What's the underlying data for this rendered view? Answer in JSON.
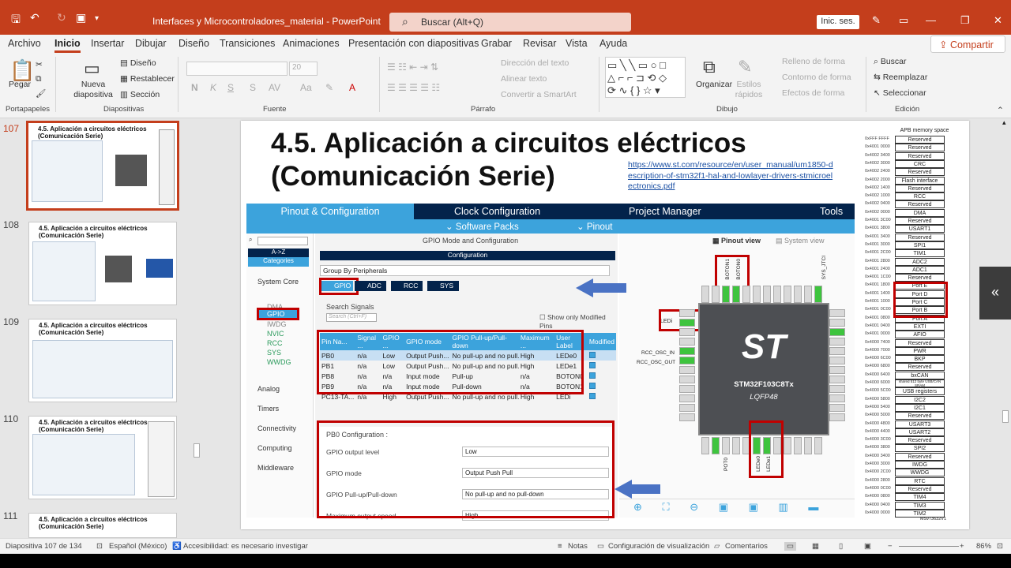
{
  "window": {
    "title": "Interfaces y Microcontroladores_material  -  PowerPoint",
    "search_placeholder": "Buscar (Alt+Q)",
    "sign_in": "Inic. ses."
  },
  "tabs": [
    "Archivo",
    "Inicio",
    "Insertar",
    "Dibujar",
    "Diseño",
    "Transiciones",
    "Animaciones",
    "Presentación con diapositivas",
    "Grabar",
    "Revisar",
    "Vista",
    "Ayuda"
  ],
  "share": "Compartir",
  "ribbon": {
    "paste": "Pegar",
    "new_slide": "Nueva diapositiva",
    "layout": "Diseño",
    "reset": "Restablecer",
    "section": "Sección",
    "font_size": "20",
    "bold": "N",
    "italic": "K",
    "underline": "S",
    "text_direction": "Dirección del texto",
    "align_text": "Alinear texto",
    "convert_smartart": "Convertir a SmartArt",
    "arrange": "Organizar",
    "quick_styles": "Estilos rápidos",
    "shape_fill": "Relleno de forma",
    "shape_outline": "Contorno de forma",
    "shape_effects": "Efectos de forma",
    "find": "Buscar",
    "replace": "Reemplazar",
    "select": "Seleccionar",
    "groups": [
      "Portapapeles",
      "Diapositivas",
      "Fuente",
      "Párrafo",
      "Dibujo",
      "Edición"
    ]
  },
  "thumbnails": [
    {
      "num": "107",
      "title": "4.5. Aplicación a circuitos eléctricos (Comunicación Serie)"
    },
    {
      "num": "108",
      "title": "4.5. Aplicación a circuitos eléctricos (Comunicación Serie)"
    },
    {
      "num": "109",
      "title": "4.5. Aplicación a circuitos eléctricos (Comunicación Serie)"
    },
    {
      "num": "110",
      "title": "4.5. Aplicación a circuitos eléctricos (Comunicación Serie)"
    },
    {
      "num": "111",
      "title": "4.5. Aplicación a circuitos eléctricos (Comunicación Serie)"
    }
  ],
  "slide": {
    "title_line1": "4.5. Aplicación a circuitos eléctricos",
    "title_line2": "(Comunicación Serie)",
    "link": "https://www.st.com/resource/en/user_manual/um1850-description-of-stm32f1-hal-and-lowlayer-drivers-stmicroelectronics.pdf",
    "page_num": "107"
  },
  "cube": {
    "tabs": [
      "Pinout & Configuration",
      "Clock Configuration",
      "Project Manager",
      "Tools"
    ],
    "subtabs": [
      "Software Packs",
      "Pinout"
    ],
    "left": {
      "sort": "A->Z",
      "categories": "Categories",
      "system": "System Core",
      "items": [
        "DMA",
        "GPIO",
        "IWDG",
        "NVIC",
        "RCC",
        "SYS",
        "WWDG"
      ],
      "sections": [
        "Analog",
        "Timers",
        "Connectivity",
        "Computing",
        "Middleware"
      ]
    },
    "mid_title": "GPIO Mode and Configuration",
    "config": "Configuration",
    "group_by": "Group By Peripherals",
    "periph_tabs": [
      "GPIO",
      "ADC",
      "RCC",
      "SYS"
    ],
    "search_signals": "Search Signals",
    "search_placeholder": "Search (Ctrl+F)",
    "show_modified": "Show only Modified Pins",
    "table_headers": [
      "Pin Na...",
      "Signal ...",
      "GPIO ...",
      "GPIO mode",
      "GPIO Pull-up/Pull-down",
      "Maximum ...",
      "User Label",
      "Modified"
    ],
    "table_rows": [
      [
        "PB0",
        "n/a",
        "Low",
        "Output Push...",
        "No pull-up and no pull...",
        "High",
        "LEDe0"
      ],
      [
        "PB1",
        "n/a",
        "Low",
        "Output Push...",
        "No pull-up and no pull...",
        "High",
        "LEDe1"
      ],
      [
        "PB8",
        "n/a",
        "n/a",
        "Input mode",
        "Pull-up",
        "n/a",
        "BOTON0"
      ],
      [
        "PB9",
        "n/a",
        "n/a",
        "Input mode",
        "Pull-down",
        "n/a",
        "BOTON1"
      ],
      [
        "PC13-TA...",
        "n/a",
        "High",
        "Output Push...",
        "No pull-up and no pull...",
        "High",
        "LEDi"
      ]
    ],
    "pb0_title": "PB0 Configuration :",
    "pb0_fields": [
      {
        "label": "GPIO output level",
        "value": "Low"
      },
      {
        "label": "GPIO mode",
        "value": "Output Push Pull"
      },
      {
        "label": "GPIO Pull-up/Pull-down",
        "value": "No pull-up and no pull-down"
      },
      {
        "label": "Maximum output speed",
        "value": "High"
      }
    ],
    "pinout_view": "Pinout view",
    "system_view": "System view",
    "chip_name": "STM32F103C8Tx",
    "chip_pkg": "LQFP48",
    "labels": {
      "boton1": "BOTON1",
      "boton0": "BOTON0",
      "ledi": "LEDi",
      "led0": "LEDe0",
      "led1": "LEDe1",
      "osc_in": "RCC_OSC_IN",
      "osc_out": "RCC_OSC_OUT",
      "sys_jtck": "SYS_JTCI",
      "poto": "POT0"
    }
  },
  "memory": {
    "title": "APB memory space",
    "rows": [
      [
        "0xFFF FFFF",
        "Reserved"
      ],
      [
        "0x4001 0000",
        "Reserved"
      ],
      [
        "0x4002 3400",
        "Reserved"
      ],
      [
        "0x4002 3000",
        "CRC"
      ],
      [
        "0x4002 2400",
        "Reserved"
      ],
      [
        "0x4002 2000",
        "Flash interface"
      ],
      [
        "0x4002 1400",
        "Reserved"
      ],
      [
        "0x4002 1000",
        "RCC"
      ],
      [
        "0x4002 0400",
        "Reserved"
      ],
      [
        "0x4002 0000",
        "DMA"
      ],
      [
        "0x4001 3C00",
        "Reserved"
      ],
      [
        "0x4001 3800",
        "USART1"
      ],
      [
        "0x4001 3400",
        "Reserved"
      ],
      [
        "0x4001 3000",
        "SPI1"
      ],
      [
        "0x4001 2C00",
        "TIM1"
      ],
      [
        "0x4001 2800",
        "ADC2"
      ],
      [
        "0x4001 2400",
        "ADC1"
      ],
      [
        "0x4001 1C00",
        "Reserved"
      ],
      [
        "0x4001 1800",
        "Port E"
      ],
      [
        "0x4001 1400",
        "Port D"
      ],
      [
        "0x4001 1000",
        "Port C"
      ],
      [
        "0x4001 0C00",
        "Port B"
      ],
      [
        "0x4001 0800",
        "Port A"
      ],
      [
        "0x4001 0400",
        "EXTI"
      ],
      [
        "0x4001 0000",
        "AFIO"
      ],
      [
        "0x4000 7400",
        "Reserved"
      ],
      [
        "0x4000 7000",
        "PWR"
      ],
      [
        "0x4000 6C00",
        "BKP"
      ],
      [
        "0x4000 6800",
        "Reserved"
      ],
      [
        "0x4000 6400",
        "bxCAN"
      ],
      [
        "0x4000 6000",
        "shared 512 byte USB/CAN SRAM"
      ],
      [
        "0x4000 5C00",
        "USB registers"
      ],
      [
        "0x4000 5800",
        "I2C2"
      ],
      [
        "0x4000 5400",
        "I2C1"
      ],
      [
        "0x4000 5000",
        "Reserved"
      ],
      [
        "0x4000 4800",
        "USART3"
      ],
      [
        "0x4000 4400",
        "USART2"
      ],
      [
        "0x4000 3C00",
        "Reserved"
      ],
      [
        "0x4000 3800",
        "SPI2"
      ],
      [
        "0x4000 3400",
        "Reserved"
      ],
      [
        "0x4000 3000",
        "IWDG"
      ],
      [
        "0x4000 2C00",
        "WWDG"
      ],
      [
        "0x4000 2800",
        "RTC"
      ],
      [
        "0x4000 0C00",
        "Reserved"
      ],
      [
        "0x4000 0800",
        "TIM4"
      ],
      [
        "0x4000 0400",
        "TIM3"
      ],
      [
        "0x4000 0000",
        "TIM2"
      ]
    ],
    "footer": "MSv73632V1"
  },
  "status": {
    "slide": "Diapositiva 107 de 134",
    "lang": "Español (México)",
    "access": "Accesibilidad: es necesario investigar",
    "notes": "Notas",
    "view_cfg": "Configuración de visualización",
    "comments": "Comentarios",
    "zoom": "86%"
  }
}
